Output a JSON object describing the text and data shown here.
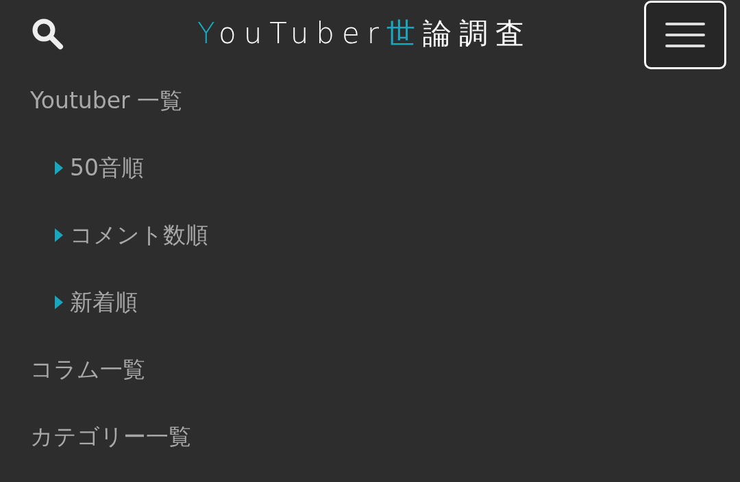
{
  "header": {
    "logo": [
      {
        "text": "Y",
        "accent": true
      },
      {
        "text": "ouTuber",
        "accent": false
      },
      {
        "text": "世",
        "accent": true
      },
      {
        "text": "論調査",
        "accent": false
      }
    ]
  },
  "menu": [
    {
      "label": "Youtuber 一覧",
      "children": [
        {
          "label": "50音順"
        },
        {
          "label": "コメント数順"
        },
        {
          "label": "新着順"
        }
      ]
    },
    {
      "label": "コラム一覧"
    },
    {
      "label": "カテゴリー一覧"
    }
  ]
}
